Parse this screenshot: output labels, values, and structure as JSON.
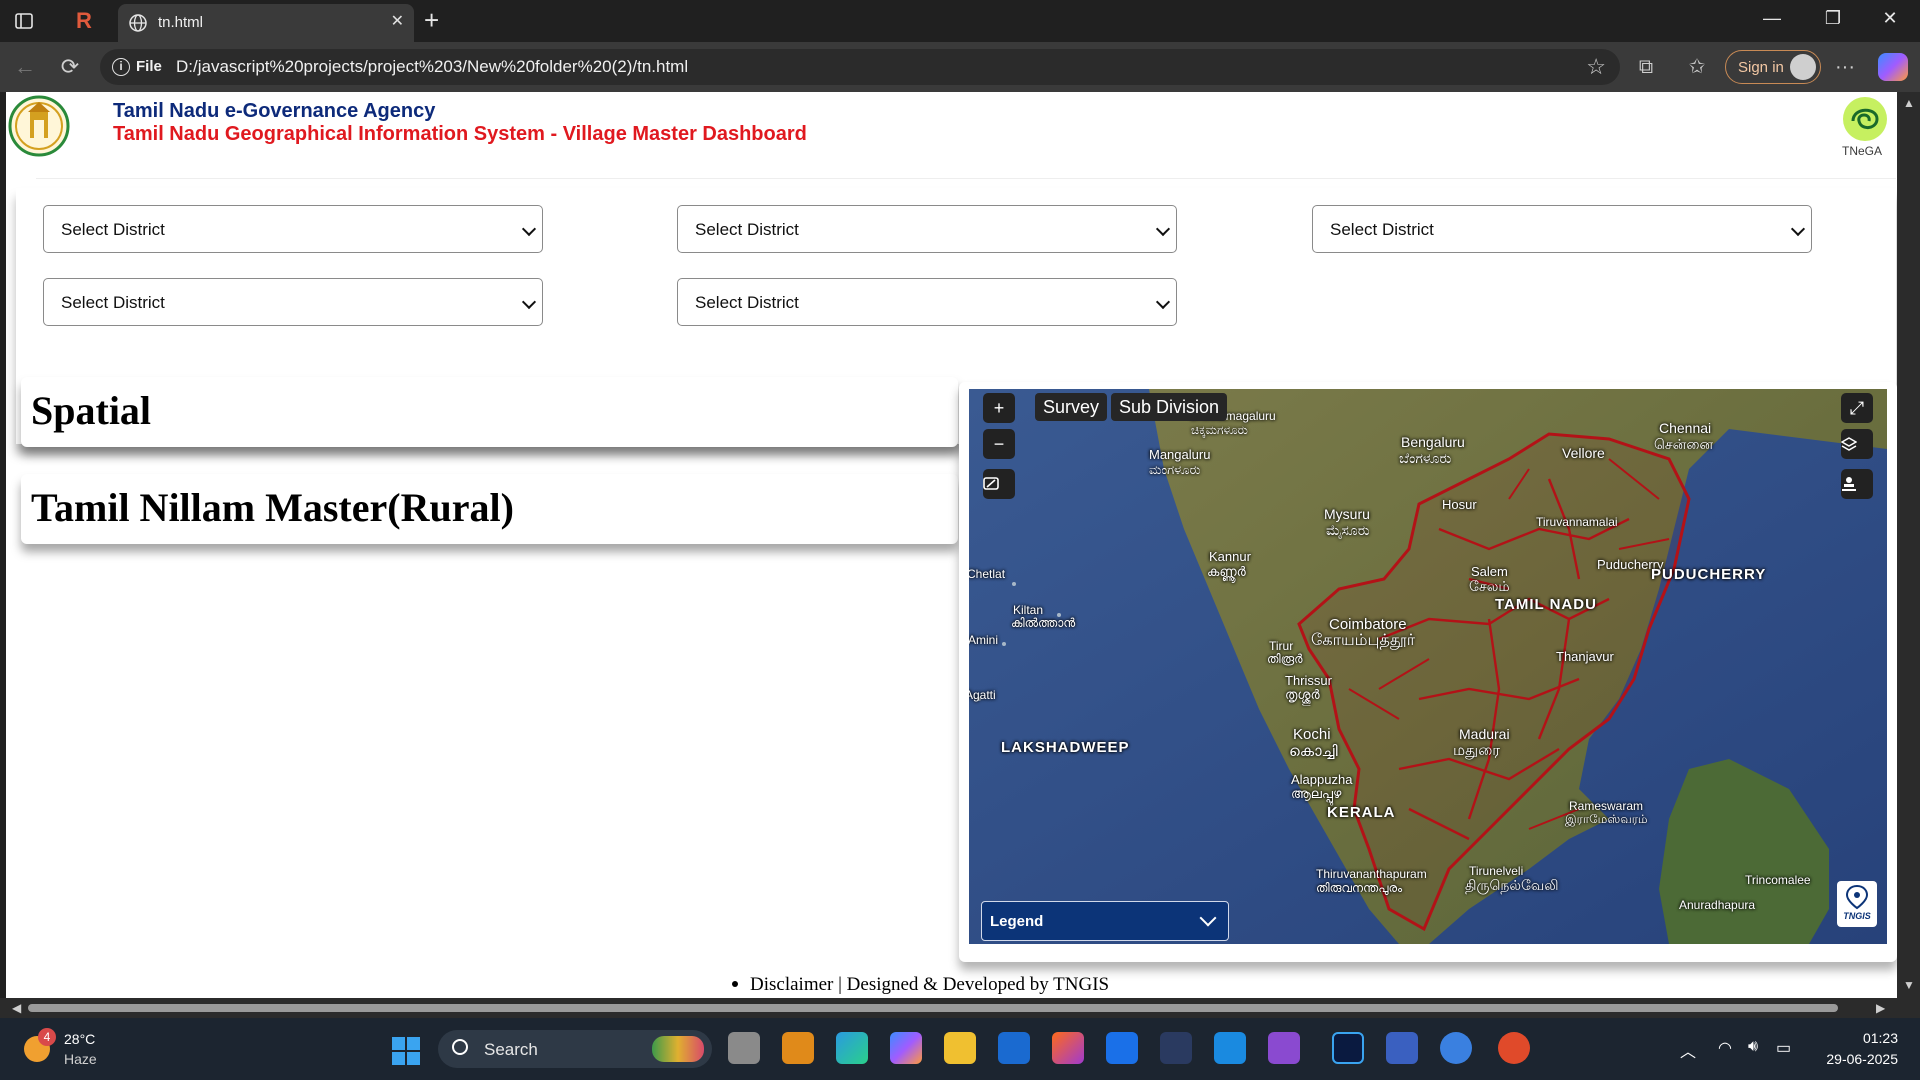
{
  "browser": {
    "tab_title": "tn.html",
    "url_scheme_label": "File",
    "url": "D:/javascript%20projects/project%203/New%20folder%20(2)/tn.html",
    "signin_label": "Sign in"
  },
  "header": {
    "agency": "Tamil Nadu e-Governance Agency",
    "system_title": "Tamil Nadu Geographical Information System - Village Master Dashboard",
    "right_logo_text": "TNeGA"
  },
  "filters": [
    {
      "selected": "Select District"
    },
    {
      "selected": "Select District"
    },
    {
      "selected": "Select District"
    },
    {
      "selected": "Select District"
    },
    {
      "selected": "Select District"
    }
  ],
  "cards": {
    "spatial": "Spatial",
    "nillam": "Tamil Nillam Master(Rural)"
  },
  "map": {
    "chips": {
      "survey": "Survey",
      "subdivision": "Sub Division"
    },
    "controls": {
      "zoom_in": "+",
      "zoom_out": "−"
    },
    "legend_label": "Legend",
    "badge_text": "TNGIS",
    "labels": {
      "chennai": "Chennai",
      "chennai_ta": "சென்னை",
      "bengaluru": "Bengaluru",
      "bengaluru_kn": "ಬೆಂಗಳೂರು",
      "chikkamagaluru": "Chikkamagaluru",
      "chikkamagaluru_kn": "ಚಿಕ್ಕಮಗಳೂರು",
      "mangaluru": "Mangaluru",
      "mangaluru_kn": "ಮಂಗಳೂರು",
      "vellore": "Vellore",
      "hosur": "Hosur",
      "mysuru": "Mysuru",
      "mysuru_kn": "ಮೈಸೂರು",
      "tiruvannamalai": "Tiruvannamalai",
      "kannur": "Kannur",
      "kannur_ml": "കണ്ണൂർ",
      "puducherry_city": "Puducherry",
      "puducherry": "PUDUCHERRY",
      "salem": "Salem",
      "salem_ta": "சேலம்",
      "tamilnadu": "TAMIL NADU",
      "kiltan": "Kiltan",
      "kiltan_ml": "കിൽത്താൻ",
      "chetlat": "Chetlat",
      "amini": "Amini",
      "coimbatore": "Coimbatore",
      "coimbatore_ta": "கோயம்புத்தூர்",
      "tirur": "Tirur",
      "tirur_ml": "തിരൂർ",
      "thanjavur": "Thanjavur",
      "thrissur": "Thrissur",
      "thrissur_ml": "തൃശ്ശൂർ",
      "agatti": "Agatti",
      "lakshadweep": "LAKSHADWEEP",
      "kochi": "Kochi",
      "kochi_ml": "കൊച്ചി",
      "madurai": "Madurai",
      "madurai_ta": "மதுரை",
      "alappuzha": "Alappuzha",
      "alappuzha_ml": "ആലപ്പുഴ",
      "kerala": "KERALA",
      "rameswaram": "Rameswaram",
      "rameswaram_ta": "இராமேஸ்வரம்",
      "thiruvananthapuram": "Thiruvananthapuram",
      "thiruvananthapuram_ml": "തിരുവനന്തപുരം",
      "tirunelveli": "Tirunelveli",
      "tirunelveli_ta": "திருநெல்வேலி",
      "trincomalee": "Trincomalee",
      "anuradhapura": "Anuradhapura"
    }
  },
  "footer": {
    "text": "Disclaimer | Designed & Developed by TNGIS"
  },
  "taskbar": {
    "weather_badge": "4",
    "temperature": "28°C",
    "weather": "Haze",
    "search_label": "Search",
    "time": "01:23",
    "date": "29-06-2025"
  },
  "colors": {
    "agency_blue": "#0d2a7a",
    "title_red": "#e0191f",
    "legend_blue": "#0c3478",
    "boundary_red": "#b31217"
  }
}
